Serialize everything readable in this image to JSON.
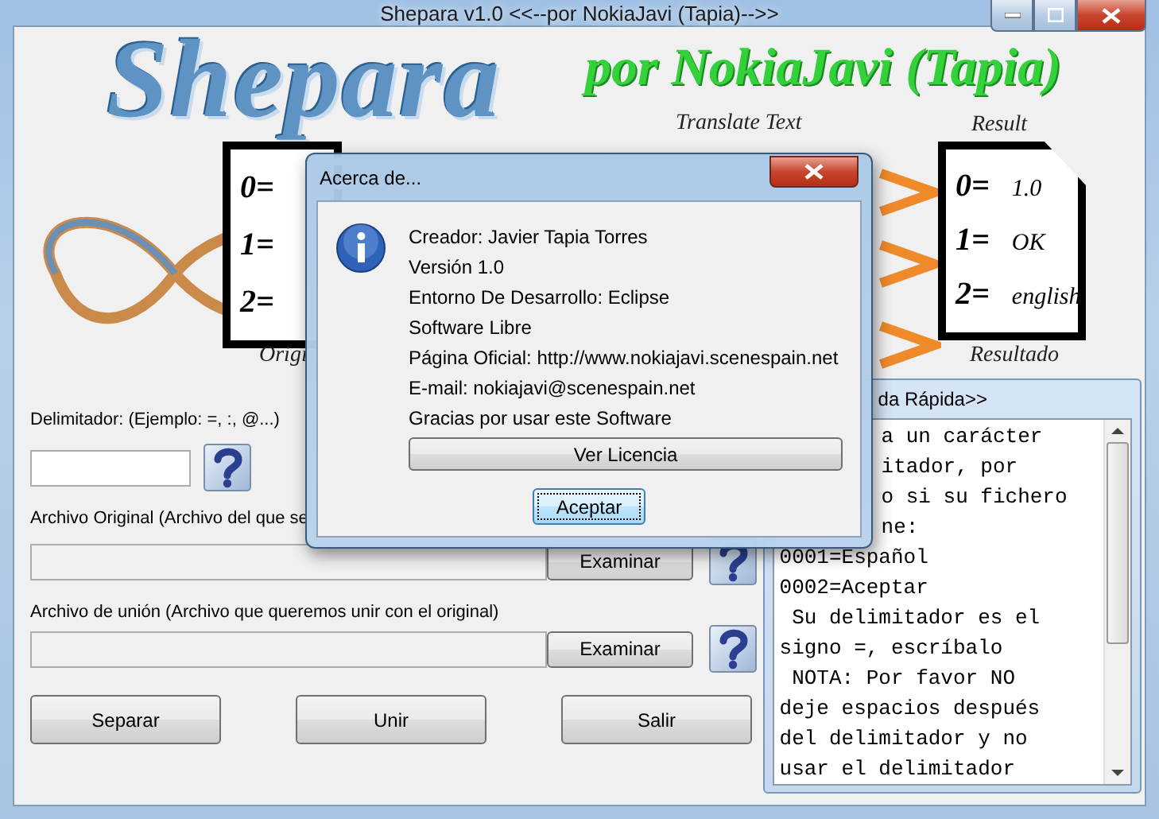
{
  "window": {
    "title": "Shepara v1.0 <<--por NokiaJavi (Tapia)-->>"
  },
  "banner": {
    "logo": "Shepara",
    "subtitle": "por NokiaJavi (Tapia)",
    "original_caption": "Origi",
    "translate_caption": "Translate Text",
    "result_caption_top": "Result",
    "result_caption_bottom": "Resultado",
    "original_lines": [
      "0=",
      "1=",
      "2="
    ],
    "result_lines": [
      {
        "key": "0=",
        "value": "1.0"
      },
      {
        "key": "1=",
        "value": "OK"
      },
      {
        "key": "2=",
        "value": "english"
      }
    ]
  },
  "form": {
    "delimiter_label": "Delimitador: (Ejemplo: =, :, @...)",
    "original_file": {
      "label": "Archivo Original (Archivo del que se",
      "button": "Examinar"
    },
    "union_file": {
      "label": "Archivo de unión (Archivo que queremos unir con el original)",
      "button": "Examinar"
    },
    "actions": [
      "Separar",
      "Unir",
      "Salir"
    ]
  },
  "help": {
    "title": "da Rápida>>",
    "lines": [
      {
        "text": "a un carácter",
        "covered": true
      },
      {
        "text": "itador, por",
        "covered": true
      },
      {
        "text": "o si su fichero",
        "covered": true
      },
      {
        "text": "ne:",
        "covered": true
      },
      {
        "text": "0001=Español",
        "covered": false
      },
      {
        "text": "0002=Aceptar",
        "covered": false
      },
      {
        "text": " Su delimitador es el",
        "covered": false
      },
      {
        "text": "signo =, escríbalo",
        "covered": false
      },
      {
        "text": " NOTA: Por favor NO",
        "covered": false
      },
      {
        "text": "deje espacios después",
        "covered": false
      },
      {
        "text": "del delimitador y no",
        "covered": false
      },
      {
        "text": "usar el delimitador",
        "covered": false
      }
    ]
  },
  "dialog": {
    "title": "Acerca de...",
    "lines": [
      "Creador: Javier Tapia Torres",
      "Versión 1.0",
      "Entorno De Desarrollo: Eclipse",
      "Software Libre",
      "Página Oficial: http://www.nokiajavi.scenespain.net",
      "E-mail: nokiajavi@scenespain.net",
      "Gracias por usar este Software"
    ],
    "buttons": [
      {
        "label": "Ver Licencia",
        "default": false
      },
      {
        "label": "Aceptar",
        "default": true
      }
    ]
  }
}
